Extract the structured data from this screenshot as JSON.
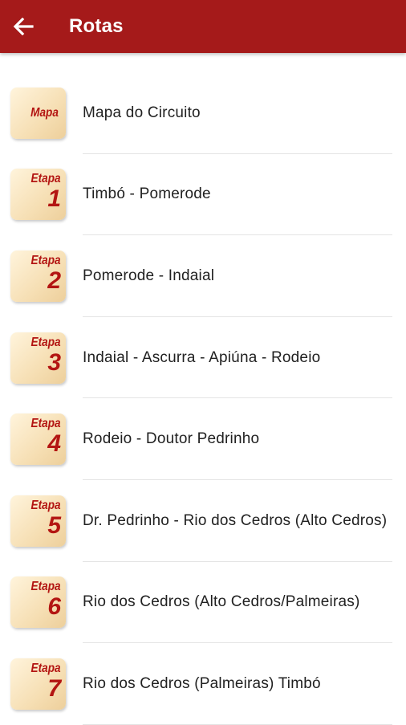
{
  "appbar": {
    "title": "Rotas",
    "color": "#a51a1a",
    "back_icon": "arrow-left-icon"
  },
  "routes": [
    {
      "badge_word": "Mapa",
      "badge_num": "",
      "label": "Mapa do Circuito"
    },
    {
      "badge_word": "Etapa",
      "badge_num": "1",
      "label": "Timbó - Pomerode"
    },
    {
      "badge_word": "Etapa",
      "badge_num": "2",
      "label": "Pomerode - Indaial"
    },
    {
      "badge_word": "Etapa",
      "badge_num": "3",
      "label": "Indaial - Ascurra - Apiúna - Rodeio"
    },
    {
      "badge_word": "Etapa",
      "badge_num": "4",
      "label": "Rodeio - Doutor Pedrinho"
    },
    {
      "badge_word": "Etapa",
      "badge_num": "5",
      "label": "Dr. Pedrinho - Rio dos Cedros (Alto Cedros)"
    },
    {
      "badge_word": "Etapa",
      "badge_num": "6",
      "label": "Rio dos Cedros (Alto Cedros/Palmeiras)"
    },
    {
      "badge_word": "Etapa",
      "badge_num": "7",
      "label": "Rio dos Cedros (Palmeiras) Timbó"
    }
  ]
}
